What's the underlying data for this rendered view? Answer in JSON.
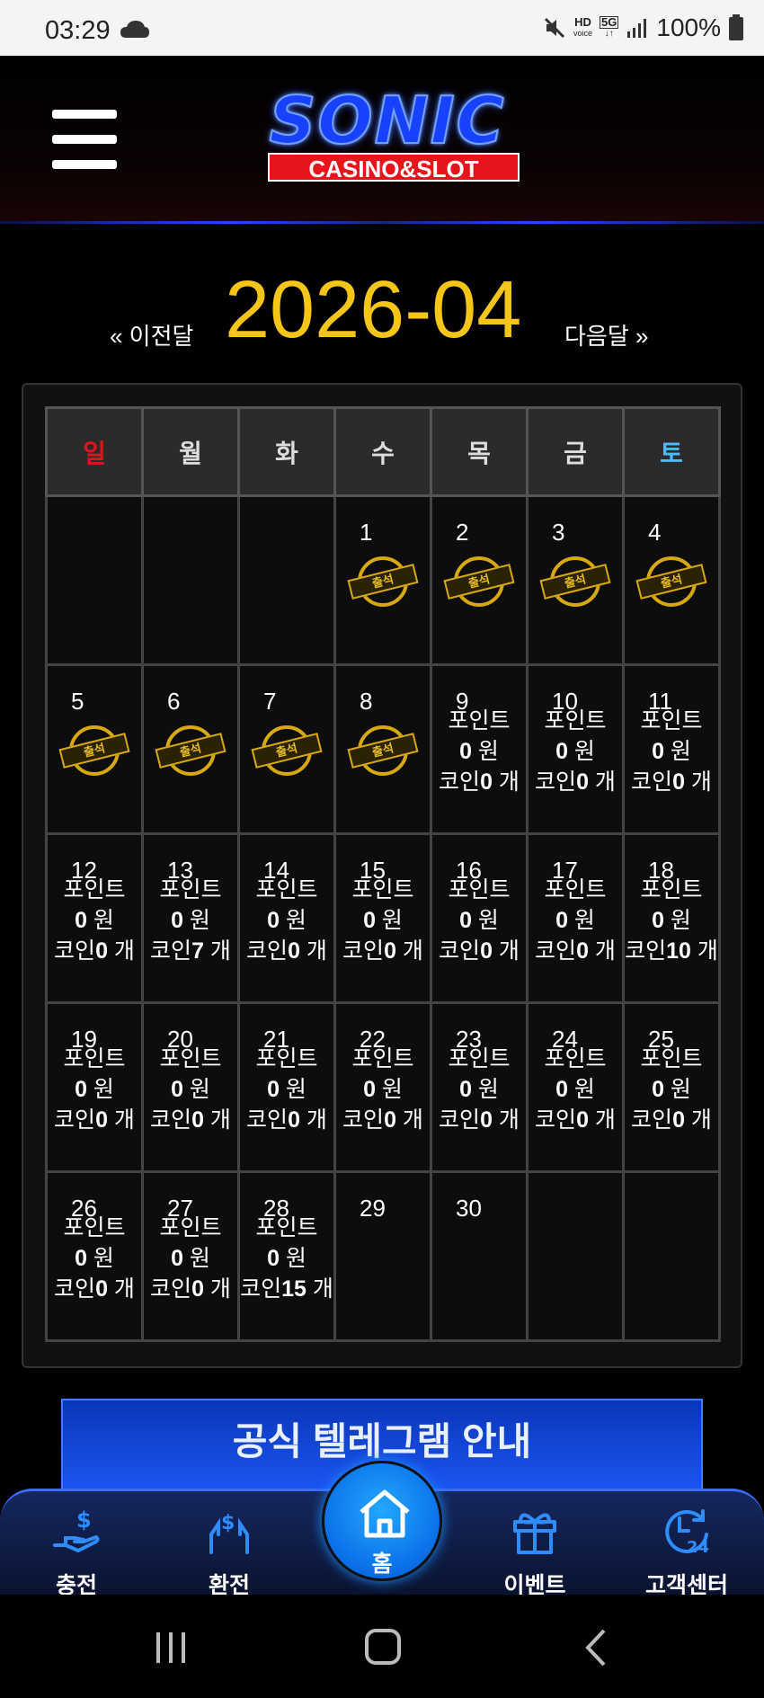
{
  "status_bar": {
    "time": "03:29",
    "hd_label": "HD",
    "hd_sub": "voice",
    "network": "5G",
    "battery": "100%"
  },
  "header": {
    "logo_title": "SONIC",
    "logo_subtitle": "CASINO&SLOT"
  },
  "month_nav": {
    "prev_label": "« 이전달",
    "title": "2026-04",
    "next_label": "다음달 »"
  },
  "calendar": {
    "weekdays": [
      "일",
      "월",
      "화",
      "수",
      "목",
      "금",
      "토"
    ],
    "stamp_text": "출석",
    "point_label": "포인트",
    "won_unit": "원",
    "coin_label": "코인",
    "coin_unit": "개",
    "weeks": [
      [
        {
          "day": ""
        },
        {
          "day": ""
        },
        {
          "day": ""
        },
        {
          "day": "1",
          "stamp": true
        },
        {
          "day": "2",
          "stamp": true
        },
        {
          "day": "3",
          "stamp": true
        },
        {
          "day": "4",
          "stamp": true
        }
      ],
      [
        {
          "day": "5",
          "stamp": true
        },
        {
          "day": "6",
          "stamp": true
        },
        {
          "day": "7",
          "stamp": true
        },
        {
          "day": "8",
          "stamp": true
        },
        {
          "day": "9",
          "points": "0",
          "coins": "0"
        },
        {
          "day": "10",
          "points": "0",
          "coins": "0"
        },
        {
          "day": "11",
          "points": "0",
          "coins": "0"
        }
      ],
      [
        {
          "day": "12",
          "points": "0",
          "coins": "0"
        },
        {
          "day": "13",
          "points": "0",
          "coins": "7"
        },
        {
          "day": "14",
          "points": "0",
          "coins": "0"
        },
        {
          "day": "15",
          "points": "0",
          "coins": "0"
        },
        {
          "day": "16",
          "points": "0",
          "coins": "0"
        },
        {
          "day": "17",
          "points": "0",
          "coins": "0"
        },
        {
          "day": "18",
          "points": "0",
          "coins": "10"
        }
      ],
      [
        {
          "day": "19",
          "points": "0",
          "coins": "0"
        },
        {
          "day": "20",
          "points": "0",
          "coins": "0"
        },
        {
          "day": "21",
          "points": "0",
          "coins": "0"
        },
        {
          "day": "22",
          "points": "0",
          "coins": "0"
        },
        {
          "day": "23",
          "points": "0",
          "coins": "0"
        },
        {
          "day": "24",
          "points": "0",
          "coins": "0"
        },
        {
          "day": "25",
          "points": "0",
          "coins": "0"
        }
      ],
      [
        {
          "day": "26",
          "points": "0",
          "coins": "0"
        },
        {
          "day": "27",
          "points": "0",
          "coins": "0"
        },
        {
          "day": "28",
          "points": "0",
          "coins": "15"
        },
        {
          "day": "29"
        },
        {
          "day": "30"
        },
        {
          "day": ""
        },
        {
          "day": ""
        }
      ]
    ]
  },
  "banner": {
    "title": "공식 텔레그램 안내"
  },
  "bottom_nav": {
    "items": [
      {
        "label": "충전",
        "icon": "deposit-icon"
      },
      {
        "label": "환전",
        "icon": "withdraw-icon"
      },
      {
        "label": "홈",
        "icon": "home-icon"
      },
      {
        "label": "이벤트",
        "icon": "gift-icon"
      },
      {
        "label": "고객센터",
        "icon": "support-24-icon"
      }
    ]
  },
  "colors": {
    "accent_gold": "#f5c518",
    "brand_blue": "#1740ff",
    "sunday_red": "#e0141c",
    "saturday_blue": "#4db8ff"
  }
}
